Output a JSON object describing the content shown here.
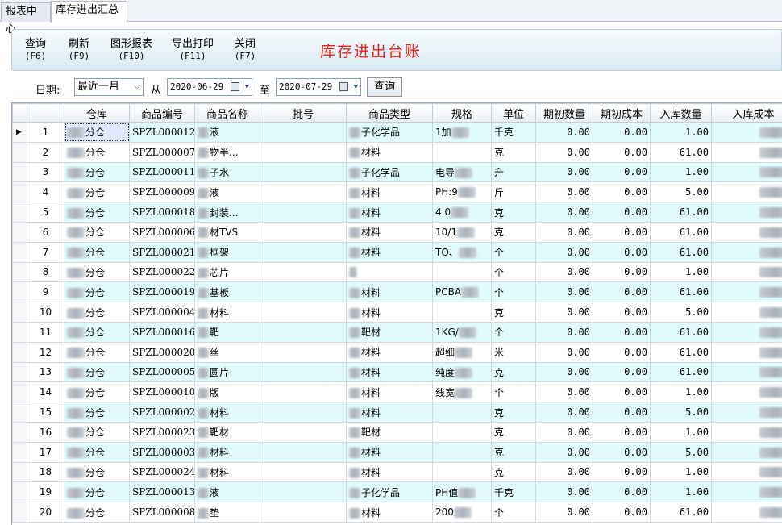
{
  "tabs": [
    "报表中心",
    "库存进出汇总"
  ],
  "toolbar": {
    "buttons": [
      {
        "label": "查询",
        "key": "(F6)"
      },
      {
        "label": "刷新",
        "key": "(F9)"
      },
      {
        "label": "图形报表",
        "key": "(F10)"
      },
      {
        "label": "导出打印",
        "key": "(F11)"
      },
      {
        "label": "关闭",
        "key": "(F7)"
      }
    ],
    "title": "库存进出台账"
  },
  "filter": {
    "date_label": "日期:",
    "period_value": "最近一月",
    "from_label": "从",
    "start_date": "2020-06-29",
    "to_label": "至",
    "end_date": "2020-07-29",
    "query_button": "查询"
  },
  "grid": {
    "columns": [
      "",
      "",
      "仓库",
      "商品编号",
      "商品名称",
      "批号",
      "商品类型",
      "规格",
      "单位",
      "期初数量",
      "期初成本",
      "入库数量",
      "入库成本"
    ],
    "rows": [
      {
        "no": "1",
        "warehouse": "分仓",
        "code": "SPZL000012",
        "name": "液",
        "batch": "",
        "type": "子化学品",
        "spec": "1加",
        "unit": "千克",
        "open_qty": "0.00",
        "open_cost": "0.00",
        "in_qty": "1.00"
      },
      {
        "no": "2",
        "warehouse": "分仓",
        "code": "SPZL000007",
        "name": "物半...",
        "batch": "",
        "type": "材料",
        "spec": "",
        "unit": "克",
        "open_qty": "0.00",
        "open_cost": "0.00",
        "in_qty": "61.00"
      },
      {
        "no": "3",
        "warehouse": "分仓",
        "code": "SPZL000011",
        "name": "子水",
        "batch": "",
        "type": "子化学品",
        "spec": "电导",
        "unit": "升",
        "open_qty": "0.00",
        "open_cost": "0.00",
        "in_qty": "1.00"
      },
      {
        "no": "4",
        "warehouse": "分仓",
        "code": "SPZL000009",
        "name": "液",
        "batch": "",
        "type": "材料",
        "spec": "PH:9",
        "unit": "斤",
        "open_qty": "0.00",
        "open_cost": "0.00",
        "in_qty": "5.00"
      },
      {
        "no": "5",
        "warehouse": "分仓",
        "code": "SPZL000018",
        "name": "封装...",
        "batch": "",
        "type": "材料",
        "spec": "4.0",
        "unit": "克",
        "open_qty": "0.00",
        "open_cost": "0.00",
        "in_qty": "61.00"
      },
      {
        "no": "6",
        "warehouse": "分仓",
        "code": "SPZL000006",
        "name": "材TVS",
        "batch": "",
        "type": "材料",
        "spec": "10/1",
        "unit": "克",
        "open_qty": "0.00",
        "open_cost": "0.00",
        "in_qty": "61.00"
      },
      {
        "no": "7",
        "warehouse": "分仓",
        "code": "SPZL000021",
        "name": "框架",
        "batch": "",
        "type": "材料",
        "spec": "TO、",
        "unit": "个",
        "open_qty": "0.00",
        "open_cost": "0.00",
        "in_qty": "61.00"
      },
      {
        "no": "8",
        "warehouse": "分仓",
        "code": "SPZL000022",
        "name": "芯片",
        "batch": "",
        "type": "",
        "spec": "",
        "unit": "个",
        "open_qty": "0.00",
        "open_cost": "0.00",
        "in_qty": "1.00"
      },
      {
        "no": "9",
        "warehouse": "分仓",
        "code": "SPZL000019",
        "name": "基板",
        "batch": "",
        "type": "材料",
        "spec": "PCBA",
        "unit": "个",
        "open_qty": "0.00",
        "open_cost": "0.00",
        "in_qty": "61.00"
      },
      {
        "no": "10",
        "warehouse": "分仓",
        "code": "SPZL000004",
        "name": "材料",
        "batch": "",
        "type": "材料",
        "spec": "",
        "unit": "克",
        "open_qty": "0.00",
        "open_cost": "0.00",
        "in_qty": "5.00"
      },
      {
        "no": "11",
        "warehouse": "分仓",
        "code": "SPZL000016",
        "name": "靶",
        "batch": "",
        "type": "靶材",
        "spec": "1KG/",
        "unit": "个",
        "open_qty": "0.00",
        "open_cost": "0.00",
        "in_qty": "61.00"
      },
      {
        "no": "12",
        "warehouse": "分仓",
        "code": "SPZL000020",
        "name": "丝",
        "batch": "",
        "type": "材料",
        "spec": "超细",
        "unit": "米",
        "open_qty": "0.00",
        "open_cost": "0.00",
        "in_qty": "61.00"
      },
      {
        "no": "13",
        "warehouse": "分仓",
        "code": "SPZL000005",
        "name": "圆片",
        "batch": "",
        "type": "材料",
        "spec": "纯度",
        "unit": "克",
        "open_qty": "0.00",
        "open_cost": "0.00",
        "in_qty": "61.00"
      },
      {
        "no": "14",
        "warehouse": "分仓",
        "code": "SPZL000010",
        "name": "版",
        "batch": "",
        "type": "材料",
        "spec": "线宽",
        "unit": "个",
        "open_qty": "0.00",
        "open_cost": "0.00",
        "in_qty": "1.00"
      },
      {
        "no": "15",
        "warehouse": "分仓",
        "code": "SPZL000002",
        "name": "材料",
        "batch": "",
        "type": "材料",
        "spec": "",
        "unit": "克",
        "open_qty": "0.00",
        "open_cost": "0.00",
        "in_qty": "5.00"
      },
      {
        "no": "16",
        "warehouse": "分仓",
        "code": "SPZL000023",
        "name": "靶材",
        "batch": "",
        "type": "靶材",
        "spec": "",
        "unit": "克",
        "open_qty": "0.00",
        "open_cost": "0.00",
        "in_qty": "1.00"
      },
      {
        "no": "17",
        "warehouse": "分仓",
        "code": "SPZL000003",
        "name": "材料",
        "batch": "",
        "type": "材料",
        "spec": "",
        "unit": "克",
        "open_qty": "0.00",
        "open_cost": "0.00",
        "in_qty": "5.00"
      },
      {
        "no": "18",
        "warehouse": "分仓",
        "code": "SPZL000024",
        "name": "材料",
        "batch": "",
        "type": "材料",
        "spec": "",
        "unit": "克",
        "open_qty": "0.00",
        "open_cost": "0.00",
        "in_qty": "1.00"
      },
      {
        "no": "19",
        "warehouse": "分仓",
        "code": "SPZL000013",
        "name": "液",
        "batch": "",
        "type": "子化学品",
        "spec": "PH值",
        "unit": "千克",
        "open_qty": "0.00",
        "open_cost": "0.00",
        "in_qty": "1.00"
      },
      {
        "no": "20",
        "warehouse": "分仓",
        "code": "SPZL000008",
        "name": "垫",
        "batch": "",
        "type": "材料",
        "spec": "200",
        "unit": "个",
        "open_qty": "0.00",
        "open_cost": "0.00",
        "in_qty": "61.00"
      }
    ]
  },
  "colors": {
    "row_alt": "#e0fbfb",
    "title_red": "#e8221b"
  }
}
